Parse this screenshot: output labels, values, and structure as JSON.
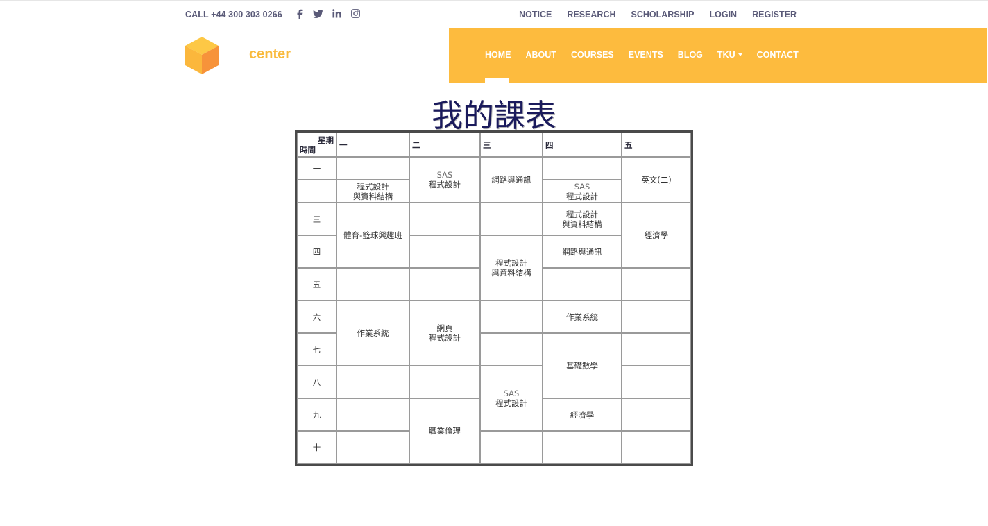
{
  "top_bar": {
    "call_text": "CALL +44 300 303 0266",
    "social": [
      "facebook-icon",
      "twitter-icon",
      "linkedin-icon",
      "instagram-icon"
    ],
    "links": [
      "NOTICE",
      "RESEARCH",
      "SCHOLARSHIP",
      "LOGIN",
      "REGISTER"
    ]
  },
  "brand": {
    "name": "center",
    "color": "#f9ba3c"
  },
  "nav": {
    "bg_color": "#fdbb3e",
    "items": [
      "HOME",
      "ABOUT",
      "COURSES",
      "EVENTS",
      "BLOG",
      "TKU",
      "CONTACT"
    ],
    "active": "HOME",
    "dropdown": "TKU"
  },
  "page_title": "我的課表",
  "schedule": {
    "corner_top": "星期",
    "corner_bottom": "時間",
    "days": [
      "一",
      "二",
      "三",
      "四",
      "五"
    ],
    "periods": [
      "一",
      "二",
      "三",
      "四",
      "五",
      "六",
      "七",
      "八",
      "九",
      "十"
    ],
    "courses": {
      "mon_p2": [
        "程式設計",
        "與資料結構"
      ],
      "mon_p34": [
        "體育-籃球興趣班"
      ],
      "mon_p67": [
        "作業系統"
      ],
      "tue_p12": [
        "SAS",
        "程式設計"
      ],
      "tue_p67": [
        "網頁",
        "程式設計"
      ],
      "tue_p910": [
        "職業倫理"
      ],
      "wed_p12": [
        "網路與通訊"
      ],
      "wed_p45": [
        "程式設計",
        "與資料結構"
      ],
      "wed_p89": [
        "SAS",
        "程式設計"
      ],
      "thu_p2": [
        "SAS",
        "程式設計"
      ],
      "thu_p3": [
        "程式設計",
        "與資料結構"
      ],
      "thu_p4": [
        "網路與通訊"
      ],
      "thu_p6": [
        "作業系統"
      ],
      "thu_p78": [
        "基礎數學"
      ],
      "thu_p9": [
        "經濟學"
      ],
      "fri_p12": [
        "英文(二)"
      ],
      "fri_p34": [
        "經濟學"
      ]
    }
  }
}
